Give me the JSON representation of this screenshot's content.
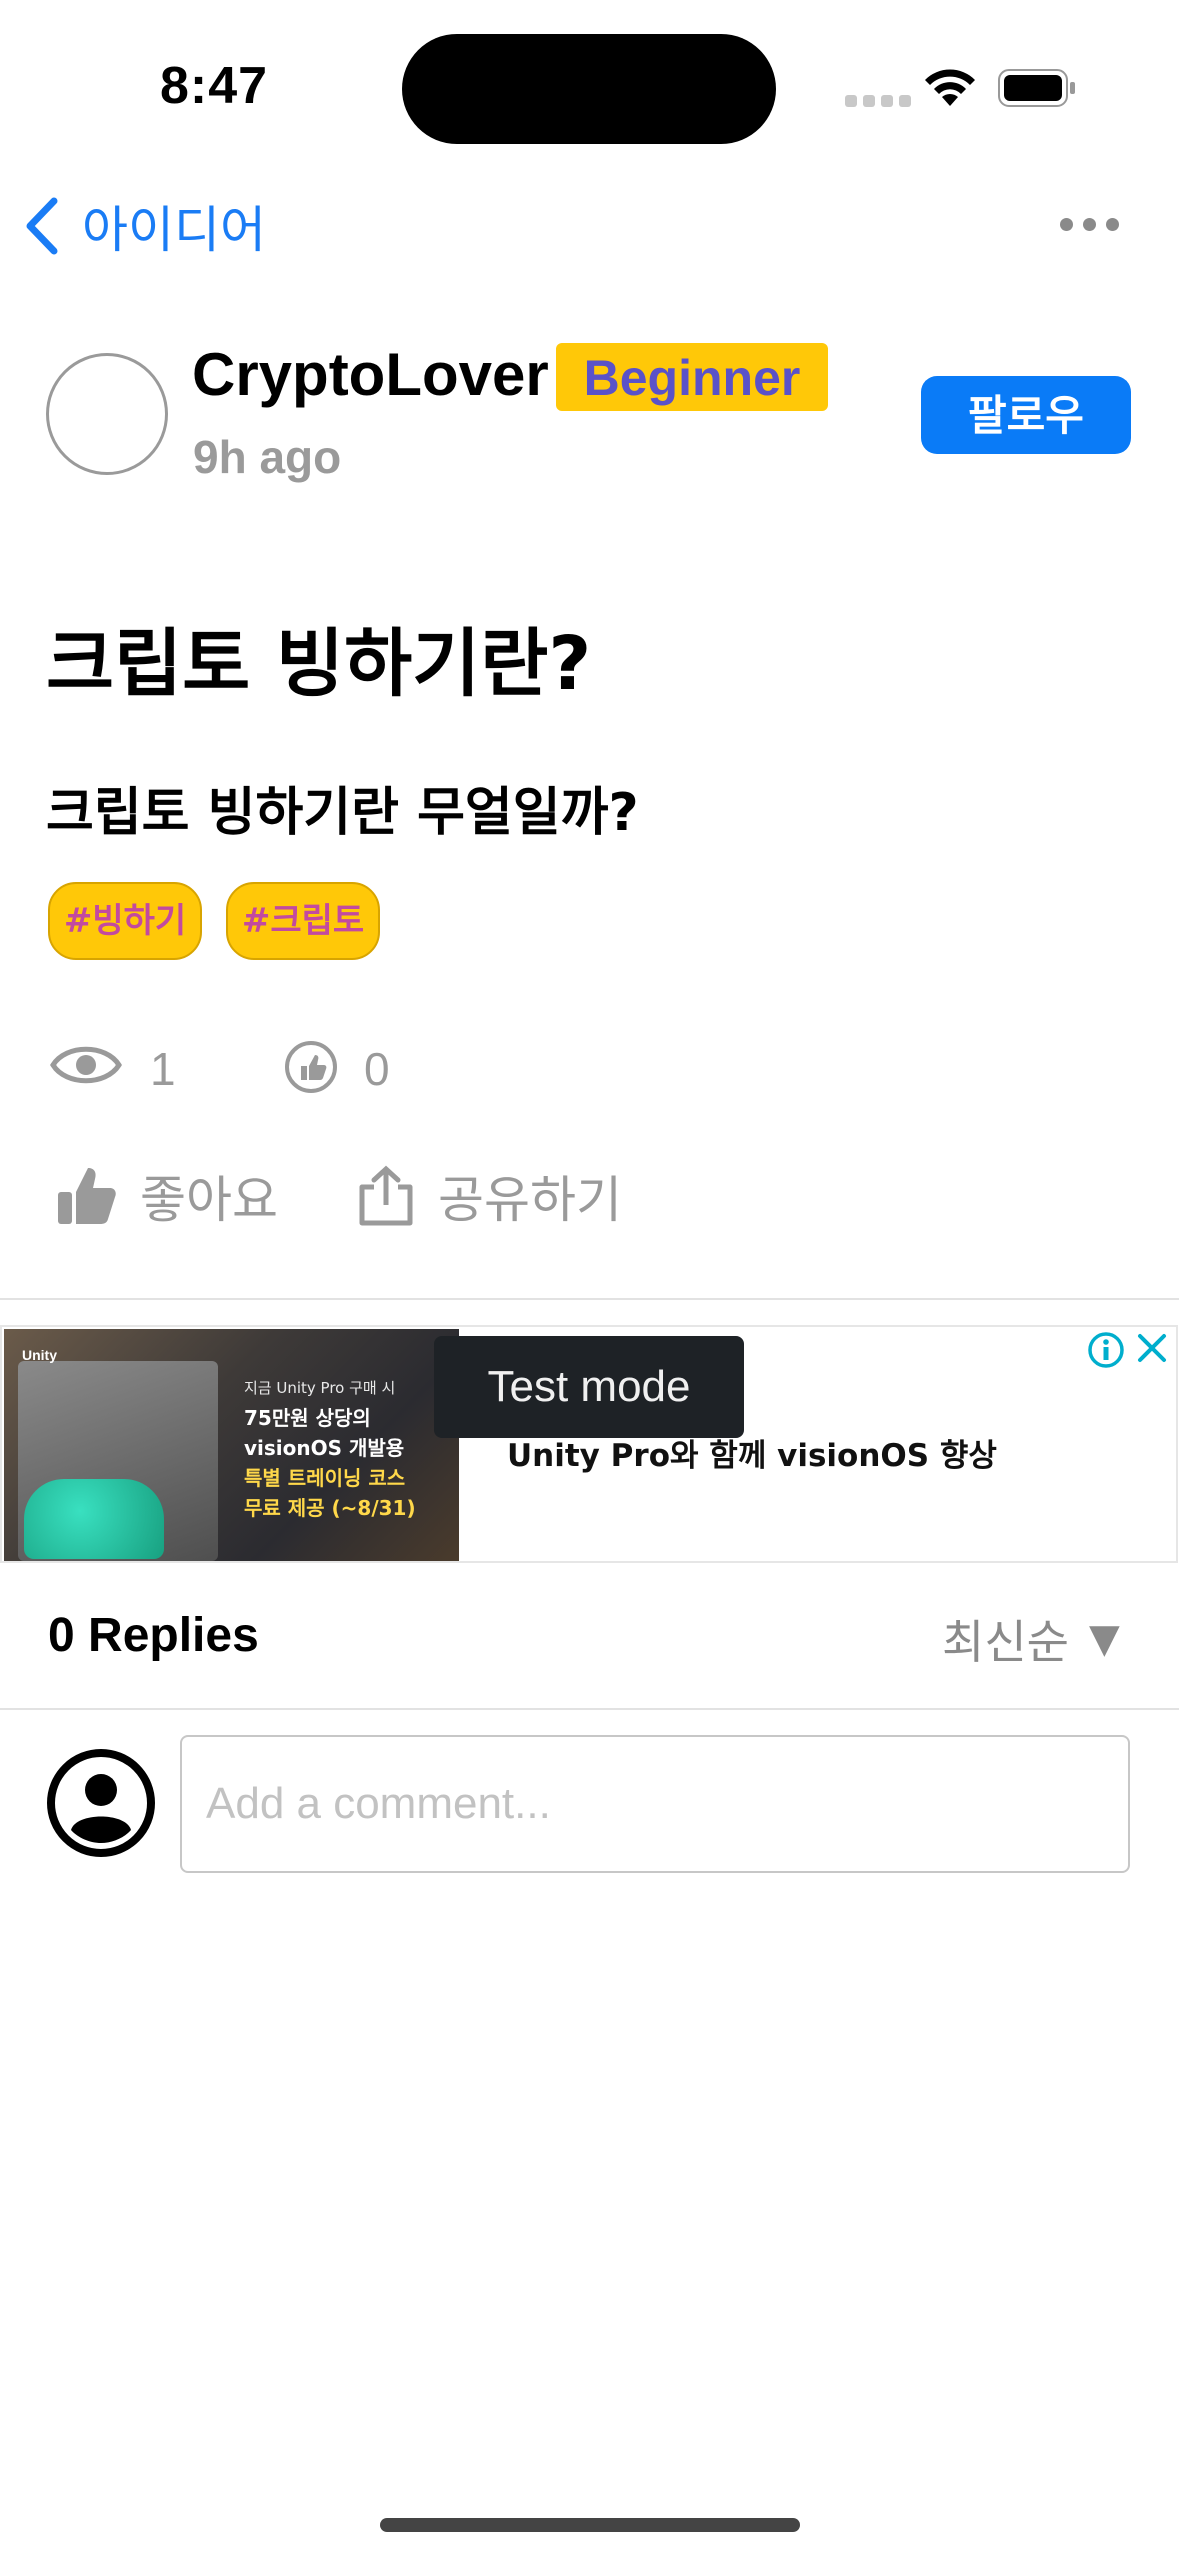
{
  "status_bar": {
    "time": "8:47"
  },
  "nav": {
    "back_label": "아이디어"
  },
  "author": {
    "name": "CryptoLover",
    "level": "Beginner",
    "posted": "9h ago",
    "follow_label": "팔로우"
  },
  "post": {
    "title": "크립토 빙하기란?",
    "body": "크립토 빙하기란 무얼일까?",
    "tags": [
      "#빙하기",
      "#크립토"
    ]
  },
  "stats": {
    "views": "1",
    "likes": "0"
  },
  "actions": {
    "like_label": "좋아요",
    "share_label": "공유하기"
  },
  "ad": {
    "brand": "Unity",
    "image_lines": [
      "지금 Unity Pro 구매 시",
      "75만원 상당의",
      "visionOS 개발용",
      "특별 트레이닝 코스",
      "무료 제공 (~8/31)"
    ],
    "headline": "Unity Pro와 함께 visionOS 향상",
    "test_mode_label": "Test mode"
  },
  "replies": {
    "count_label": "0 Replies",
    "sort_label": "최신순"
  },
  "comment": {
    "placeholder": "Add a comment..."
  },
  "colors": {
    "accent": "#0a7bf7",
    "badge": "#ffc808",
    "muted": "#9a9a9a"
  }
}
